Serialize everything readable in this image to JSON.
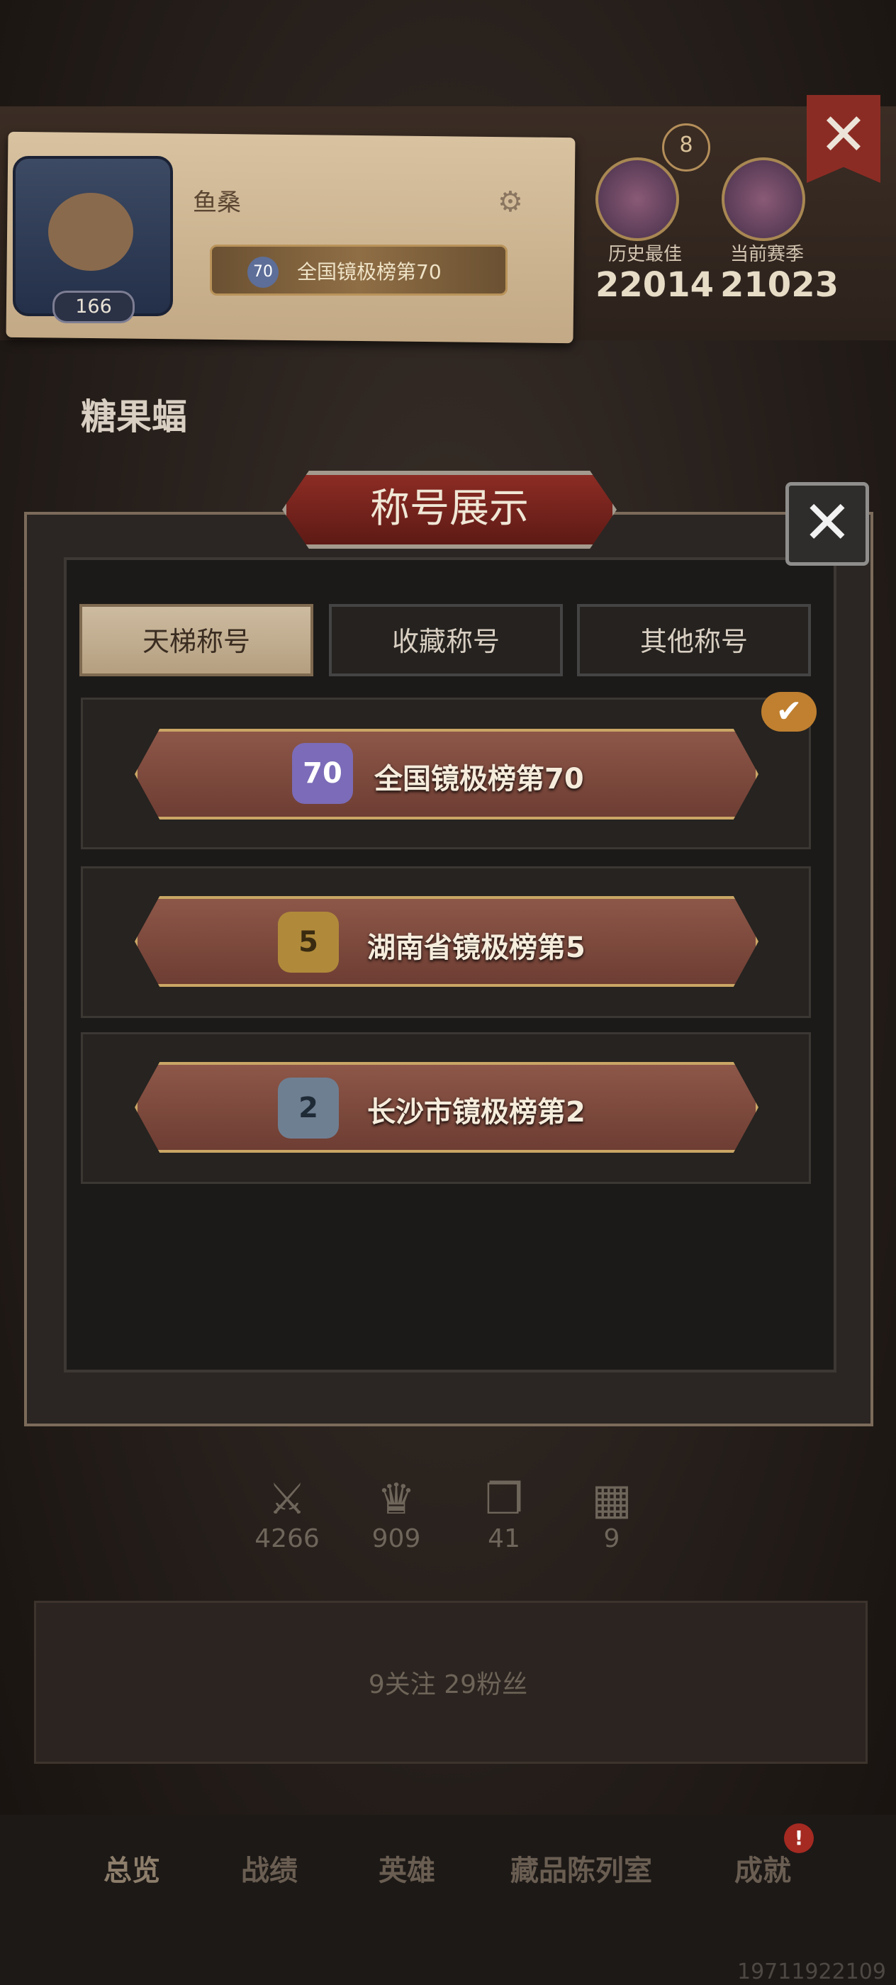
{
  "profile": {
    "username": "鱼桑",
    "level": "166",
    "title_badge_number": "70",
    "title_badge_text": "全国镜极榜第70",
    "rank_tier": "8",
    "best_label": "历史最佳",
    "best_value": "22014",
    "season_label": "当前赛季",
    "season_value": "21023",
    "nickname": "糖果蝠"
  },
  "modal": {
    "title": "称号展示",
    "tabs": [
      "天梯称号",
      "收藏称号",
      "其他称号"
    ],
    "active_tab": "天梯称号",
    "titles": [
      {
        "rank": "70",
        "text": "全国镜极榜第70",
        "selected": true
      },
      {
        "rank": "5",
        "text": "湖南省镜极榜第5",
        "selected": false
      },
      {
        "rank": "2",
        "text": "长沙市镜极榜第2",
        "selected": false
      }
    ]
  },
  "stats": [
    {
      "icon": "swords-icon",
      "value": "4266"
    },
    {
      "icon": "crown-icon",
      "value": "909"
    },
    {
      "icon": "card-icon",
      "value": "41"
    },
    {
      "icon": "board-icon",
      "value": "9"
    }
  ],
  "social": {
    "text": "9关注  29粉丝"
  },
  "nav": {
    "items": [
      "总览",
      "战绩",
      "英雄",
      "藏品陈列室",
      "成就"
    ],
    "active": "总览",
    "badge": "!"
  },
  "footer": {
    "uid": "19711922109"
  },
  "colors": {
    "accent_red": "#8c2c24",
    "gold": "#caa665",
    "check": "#c08030"
  }
}
